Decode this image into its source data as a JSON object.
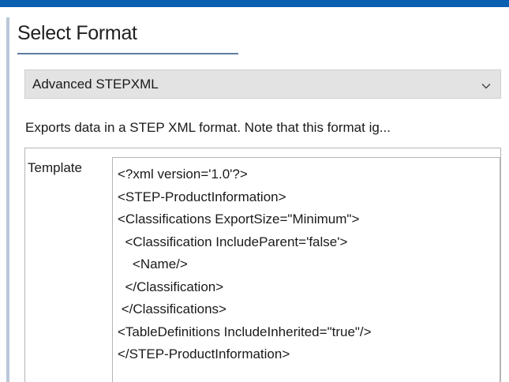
{
  "section": {
    "title": "Select Format"
  },
  "format_select": {
    "selected": "Advanced STEPXML",
    "icon": "chevron-down-icon"
  },
  "description": "Exports data in a STEP XML format. Note that this format ig...",
  "template": {
    "label": "Template",
    "lines": [
      "<?xml version='1.0'?>",
      "<STEP-ProductInformation>",
      "<Classifications ExportSize=\"Minimum\">",
      "  <Classification IncludeParent='false'>",
      "    <Name/>",
      "  </Classification>",
      " </Classifications>",
      "<TableDefinitions IncludeInherited=\"true\"/>",
      "</STEP-ProductInformation>"
    ]
  },
  "colors": {
    "accent_bar": "#0a5fb0",
    "select_background": "#e3e3e3",
    "underline": "#5e7e9e"
  }
}
